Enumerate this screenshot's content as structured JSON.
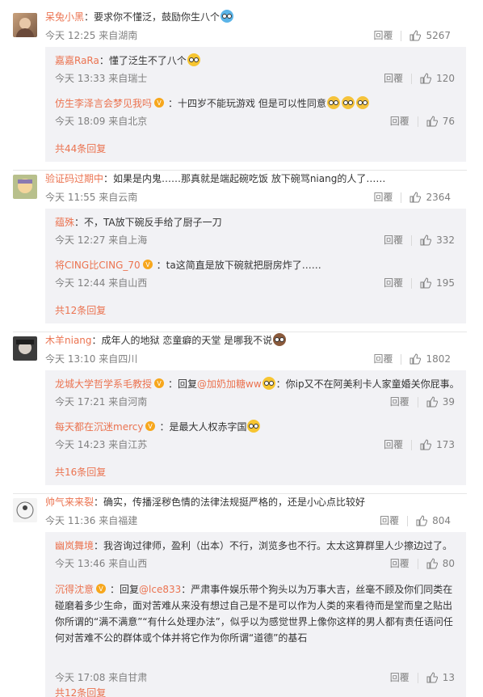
{
  "ui": {
    "reply_label": "回覆",
    "like_counts": [
      "5267",
      "120",
      "76",
      "2364",
      "332",
      "195",
      "1802",
      "39",
      "173",
      "804",
      "80",
      "13"
    ]
  },
  "comments": [
    {
      "nick": "呆兔小黑",
      "text": "：要求你不懂泛，鼓励你生八个",
      "time": "今天 12:25 来自湖南",
      "likes": "5267",
      "replies": [
        {
          "nick": "嘉嘉RaRa",
          "text": "：懂了泛生不了八个",
          "time": "今天 13:33 来自瑞士",
          "likes": "120"
        },
        {
          "nick": "仿生李泽言会梦见我吗",
          "text": "：十四岁不能玩游戏 但是可以性同意",
          "time": "今天 18:09 来自北京",
          "likes": "76"
        }
      ],
      "more": "共44条回复"
    },
    {
      "nick": "验证码过期中",
      "text": "：如果是内鬼……那真就是端起碗吃饭 放下碗骂niang的人了……",
      "time": "今天 11:55 来自云南",
      "likes": "2364",
      "replies": [
        {
          "nick": "蕴殊",
          "text": "：不，TA放下碗反手给了厨子一刀",
          "time": "今天 12:27 来自上海",
          "likes": "332"
        },
        {
          "nick": "将CING比CING_70",
          "text": "：ta这简直是放下碗就把厨房炸了……",
          "time": "今天 12:44 来自山西",
          "likes": "195"
        }
      ],
      "more": "共12条回复"
    },
    {
      "nick": "木羊niang",
      "text": "：成年人的地狱 恋童癖的天堂 是哪我不说",
      "time": "今天 13:10 来自四川",
      "likes": "1802",
      "replies": [
        {
          "nick": "龙城大学哲学系毛教授",
          "text_a": "：回复",
          "mention": "@加奶加糖ww",
          "text_b": "：你ip又不在阿美利卡人家童婚关你屁事。",
          "time": "今天 17:21 来自河南",
          "likes": "39"
        },
        {
          "nick": "每天都在沉迷mercy",
          "text": "：是最大人权赤字国",
          "time": "今天 14:23 来自江苏",
          "likes": "173"
        }
      ],
      "more": "共16条回复"
    },
    {
      "nick": "帅气来来裂",
      "text": "：确实，传播淫秽色情的法律法规挺严格的，还是小心点比较好",
      "time": "今天 11:36 来自福建",
      "likes": "804",
      "replies": [
        {
          "nick": "幽岚舞境",
          "text": "：我咨询过律师，盈利（出本）不行，浏览多也不行。太太这算群里人少擦边过了。",
          "time": "今天 13:46 来自山西",
          "likes": "80"
        },
        {
          "nick": "沉得沈意",
          "text_a": "：回复",
          "mention": "@lce833",
          "text_b": "：严肃事件娱乐带个狗头以为万事大吉，丝毫不顾及你们同类在碰磨着多少生命，面对苦难从来没有想过自己是不是可以作为人类的来看待而是堂而皇之贴出你所谓的“满不满意”“有什么处理办法”，似乎以为感觉世界上像你这样的男人都有责任语问任何对苦难不公的群体或个体并将它作为你所谓“道德”的基石",
          "time": "今天 17:08 来自甘肃",
          "likes": "13"
        }
      ],
      "more": "共12条回复"
    }
  ]
}
